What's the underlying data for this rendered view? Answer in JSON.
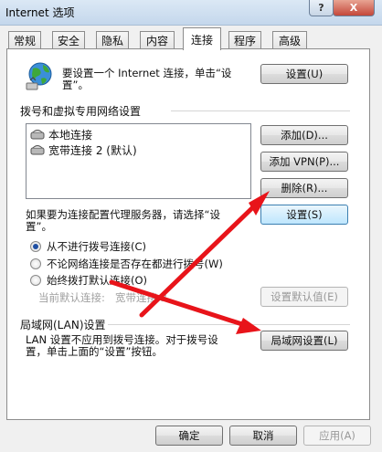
{
  "window": {
    "title": "Internet 选项",
    "help_glyph": "?",
    "close_glyph": "X"
  },
  "tabs": [
    {
      "label": "常规"
    },
    {
      "label": "安全"
    },
    {
      "label": "隐私"
    },
    {
      "label": "内容"
    },
    {
      "label": "连接",
      "active": true
    },
    {
      "label": "程序"
    },
    {
      "label": "高级"
    }
  ],
  "setup": {
    "text_line1": "要设置一个 Internet 连接，单击“设",
    "text_line2": "置”。",
    "button": "设置(U)"
  },
  "dialup": {
    "title": "拨号和虚拟专用网络设置",
    "items": [
      "本地连接",
      "宽带连接 2 (默认)"
    ],
    "add_button": "添加(D)...",
    "add_vpn_button": "添加 VPN(P)...",
    "delete_button": "删除(R)...",
    "proxy_text_line1": "如果要为连接配置代理服务器，请选择“设",
    "proxy_text_line2": "置”。",
    "settings_button": "设置(S)",
    "options": [
      {
        "label": "从不进行拨号连接(C)",
        "checked": true
      },
      {
        "label": "不论网络连接是否存在都进行拨号(W)",
        "checked": false
      },
      {
        "label": "始终拨打默认连接(O)",
        "checked": false
      }
    ],
    "current_default_label": "当前默认连接:",
    "current_default_value": "宽带连接 2",
    "set_default_button": "设置默认值(E)"
  },
  "lan": {
    "title": "局域网(LAN)设置",
    "text_line1": "LAN 设置不应用到拨号连接。对于拨号设",
    "text_line2": "置，单击上面的“设置”按钮。",
    "button": "局域网设置(L)"
  },
  "footer": {
    "ok": "确定",
    "cancel": "取消",
    "apply": "应用(A)"
  },
  "colors": {
    "annotation_arrow": "#e8141a",
    "focus_border": "#3c7fb1"
  }
}
